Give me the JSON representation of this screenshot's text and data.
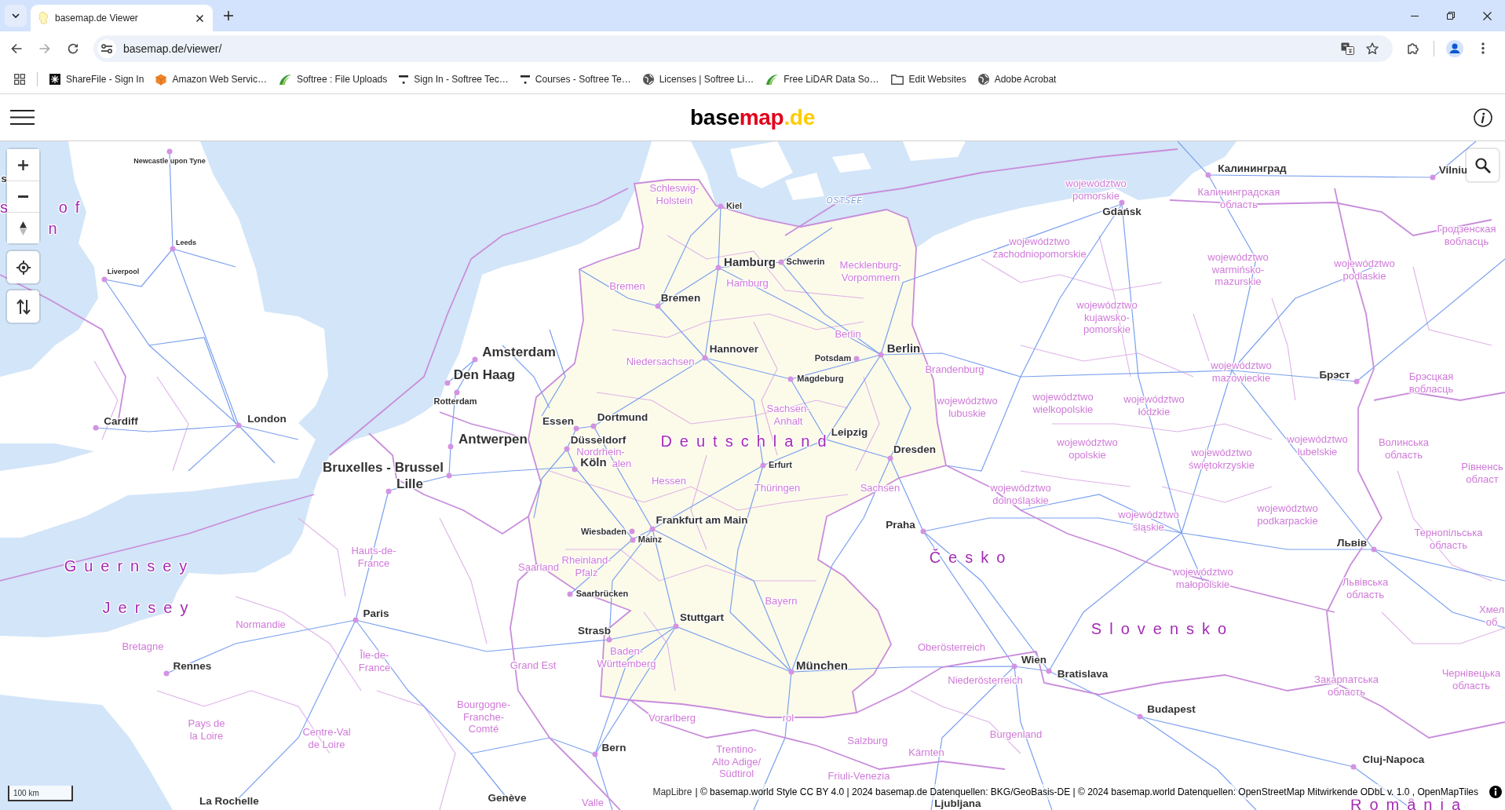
{
  "browser": {
    "tabs": [
      {
        "title": "basemap.de Viewer",
        "selected": true
      }
    ],
    "url": "basemap.de/viewer/",
    "bookmarks": [
      {
        "label": "ShareFile - Sign In",
        "kind": "tile"
      },
      {
        "label": "Amazon Web Servic…",
        "kind": "cube"
      },
      {
        "label": "Softree : File Uploads",
        "kind": "swoosh"
      },
      {
        "label": "Sign In - Softree Tec…",
        "kind": "tee"
      },
      {
        "label": "Courses - Softree Te…",
        "kind": "tee"
      },
      {
        "label": "Licenses | Softree Li…",
        "kind": "globe"
      },
      {
        "label": "Free LiDAR Data So…",
        "kind": "swoosh"
      },
      {
        "label": "Edit Websites",
        "kind": "folder"
      },
      {
        "label": "Adobe Acrobat",
        "kind": "globe"
      }
    ]
  },
  "header": {
    "logo": [
      {
        "text": "base",
        "color": "#000000"
      },
      {
        "text": "map",
        "color": "#e2001a"
      },
      {
        "text": ".de",
        "color": "#ffcc00"
      }
    ]
  },
  "map": {
    "labels": [
      {
        "text": "Newcastle upon Tyne",
        "kind": "village"
      },
      {
        "text": "Калининград",
        "kind": "city"
      },
      {
        "text": "Vilniu",
        "kind": "city"
      },
      {
        "text": "s",
        "kind": "city"
      },
      {
        "text": "s",
        "kind": "country"
      },
      {
        "text": "of",
        "kind": "country"
      },
      {
        "text": "Schleswig-\nHolstein",
        "kind": "region"
      },
      {
        "text": "Kiel",
        "kind": "town"
      },
      {
        "text": "OSTSEE",
        "kind": "sea"
      },
      {
        "text": "województwo\npomorskie",
        "kind": "region"
      },
      {
        "text": "Калининградская\nобласть",
        "kind": "region"
      },
      {
        "text": "Gdańsk",
        "kind": "city"
      },
      {
        "text": "n",
        "kind": "country"
      },
      {
        "text": "Leeds",
        "kind": "village"
      },
      {
        "text": "województwo\nzachodniopomorskie",
        "kind": "region"
      },
      {
        "text": "Гродзенская\nвобласць",
        "kind": "region"
      },
      {
        "text": "Liverpool",
        "kind": "village"
      },
      {
        "text": "Hamburg",
        "kind": "major"
      },
      {
        "text": "Schwerin",
        "kind": "town"
      },
      {
        "text": "Mecklenburg-\nVorpommern",
        "kind": "region"
      },
      {
        "text": "województwo\nwarmińsko-\nmazurskie",
        "kind": "region"
      },
      {
        "text": "województwo\npodlaskie",
        "kind": "region"
      },
      {
        "text": "Bremen",
        "kind": "region"
      },
      {
        "text": "Hamburg",
        "kind": "region"
      },
      {
        "text": "Bremen",
        "kind": "city"
      },
      {
        "text": "Berlin",
        "kind": "region"
      },
      {
        "text": "województwo\nkujawsko-\npomorskie",
        "kind": "region"
      },
      {
        "text": "Amsterdam",
        "kind": "metropolis"
      },
      {
        "text": "Den Haag",
        "kind": "metropolis"
      },
      {
        "text": "Niedersachsen",
        "kind": "region"
      },
      {
        "text": "Hannover",
        "kind": "city"
      },
      {
        "text": "Potsdam",
        "kind": "town"
      },
      {
        "text": "Berlin",
        "kind": "major"
      },
      {
        "text": "Magdeburg",
        "kind": "town"
      },
      {
        "text": "Brandenburg",
        "kind": "region"
      },
      {
        "text": "województwo\nmazowieckie",
        "kind": "region"
      },
      {
        "text": "Брэст",
        "kind": "city"
      },
      {
        "text": "Брэсцкая\nвобласць",
        "kind": "region"
      },
      {
        "text": "Cardiff",
        "kind": "city"
      },
      {
        "text": "London",
        "kind": "city"
      },
      {
        "text": "Rotterdam",
        "kind": "town"
      },
      {
        "text": "Essen",
        "kind": "city"
      },
      {
        "text": "Dortmund",
        "kind": "city"
      },
      {
        "text": "Sachsen-\nAnhalt",
        "kind": "region"
      },
      {
        "text": "województwo\nlubuskie",
        "kind": "region"
      },
      {
        "text": "województwo\nwielkopolskie",
        "kind": "region"
      },
      {
        "text": "województwo\nłódzkie",
        "kind": "region"
      },
      {
        "text": "Antwerpen",
        "kind": "metropolis"
      },
      {
        "text": "Düsseldorf",
        "kind": "city"
      },
      {
        "text": "Nordrhein-",
        "kind": "region"
      },
      {
        "text": "Deutschland",
        "kind": "country"
      },
      {
        "text": "Leipzig",
        "kind": "city"
      },
      {
        "text": "Dresden",
        "kind": "city"
      },
      {
        "text": "województwo\nopolskie",
        "kind": "region"
      },
      {
        "text": "województwo\nświętokrzyskie",
        "kind": "region"
      },
      {
        "text": "województwo\nlubelskie",
        "kind": "region"
      },
      {
        "text": "Волинська\nобласть",
        "kind": "region"
      },
      {
        "text": "Bruxelles - Brussel",
        "kind": "metropolis"
      },
      {
        "text": "Lille",
        "kind": "metropolis"
      },
      {
        "text": "Köln",
        "kind": "major"
      },
      {
        "text": "alen",
        "kind": "region"
      },
      {
        "text": "Hessen",
        "kind": "region"
      },
      {
        "text": "Erfurt",
        "kind": "town"
      },
      {
        "text": "Рівненсь\nобласт",
        "kind": "region"
      },
      {
        "text": "Thüringen",
        "kind": "region"
      },
      {
        "text": "Sachsen",
        "kind": "region"
      },
      {
        "text": "województwo\ndolnośląskie",
        "kind": "region"
      },
      {
        "text": "Frankfurt am Main",
        "kind": "city"
      },
      {
        "text": "Praha",
        "kind": "city"
      },
      {
        "text": "województwo\nśląskie",
        "kind": "region"
      },
      {
        "text": "województwo\npodkarpackie",
        "kind": "region"
      },
      {
        "text": "Wiesbaden",
        "kind": "town"
      },
      {
        "text": "Mainz",
        "kind": "town"
      },
      {
        "text": "Львів",
        "kind": "city"
      },
      {
        "text": "Тернопільська\nобласть",
        "kind": "region"
      },
      {
        "text": "Guernsey",
        "kind": "country"
      },
      {
        "text": "Hauts-de-\nFrance",
        "kind": "region"
      },
      {
        "text": "Saarland",
        "kind": "region"
      },
      {
        "text": "Rheinland-\nPfalz",
        "kind": "region"
      },
      {
        "text": "Saarbrücken",
        "kind": "town"
      },
      {
        "text": "Česko",
        "kind": "country"
      },
      {
        "text": "województwo\nmałopolskie",
        "kind": "region"
      },
      {
        "text": "Львівська\nобласть",
        "kind": "region"
      },
      {
        "text": "Jersey",
        "kind": "country"
      },
      {
        "text": "Normandie",
        "kind": "region"
      },
      {
        "text": "Paris",
        "kind": "city"
      },
      {
        "text": "Strasb",
        "kind": "city"
      },
      {
        "text": "Stuttgart",
        "kind": "city"
      },
      {
        "text": "Bayern",
        "kind": "region"
      },
      {
        "text": "Хмел\nоб",
        "kind": "region"
      },
      {
        "text": "Slovensko",
        "kind": "country"
      },
      {
        "text": "Bretagne",
        "kind": "region"
      },
      {
        "text": "Rennes",
        "kind": "city"
      },
      {
        "text": "Île-de-\nFrance",
        "kind": "region"
      },
      {
        "text": "Grand Est",
        "kind": "region"
      },
      {
        "text": "Baden-\nWürttemberg",
        "kind": "region"
      },
      {
        "text": "München",
        "kind": "major"
      },
      {
        "text": "Oberösterreich",
        "kind": "region"
      },
      {
        "text": "Wien",
        "kind": "city"
      },
      {
        "text": "Niederösterreich",
        "kind": "region"
      },
      {
        "text": "Bratislava",
        "kind": "city"
      },
      {
        "text": "Закарпатська\nобласть",
        "kind": "region"
      },
      {
        "text": "Чернівецька\nобласть",
        "kind": "region"
      },
      {
        "text": "Pays de\nla Loire",
        "kind": "region"
      },
      {
        "text": "Centre-Val\nde Loire",
        "kind": "region"
      },
      {
        "text": "Bourgogne-\nFranche-\nComté",
        "kind": "region"
      },
      {
        "text": "Vorarlberg",
        "kind": "region"
      },
      {
        "text": "rol",
        "kind": "region"
      },
      {
        "text": "Salzburg",
        "kind": "region"
      },
      {
        "text": "Burgenland",
        "kind": "region"
      },
      {
        "text": "Budapest",
        "kind": "city"
      },
      {
        "text": "Bern",
        "kind": "city"
      },
      {
        "text": "Trentino-\nAlto Adige/\nSüdtirol",
        "kind": "region"
      },
      {
        "text": "Kärnten",
        "kind": "region"
      },
      {
        "text": "Cluj-Napoca",
        "kind": "city"
      },
      {
        "text": "Friuli-Venezia",
        "kind": "region"
      },
      {
        "text": "La Rochelle",
        "kind": "city"
      },
      {
        "text": "Genève",
        "kind": "city"
      },
      {
        "text": "Valle",
        "kind": "region"
      },
      {
        "text": "Ljubljana",
        "kind": "city"
      },
      {
        "text": "România",
        "kind": "country"
      }
    ],
    "scale": "100 km",
    "attribution": {
      "link": "MapLibre",
      "text": "| © basemap.world Style CC BY 4.0 | 2024 basemap.de Datenquellen: BKG/GeoBasis-DE | © 2024 basemap.world Datenquellen: OpenStreetMap Mitwirkende ODbL v. 1.0 , OpenMapTiles"
    }
  }
}
